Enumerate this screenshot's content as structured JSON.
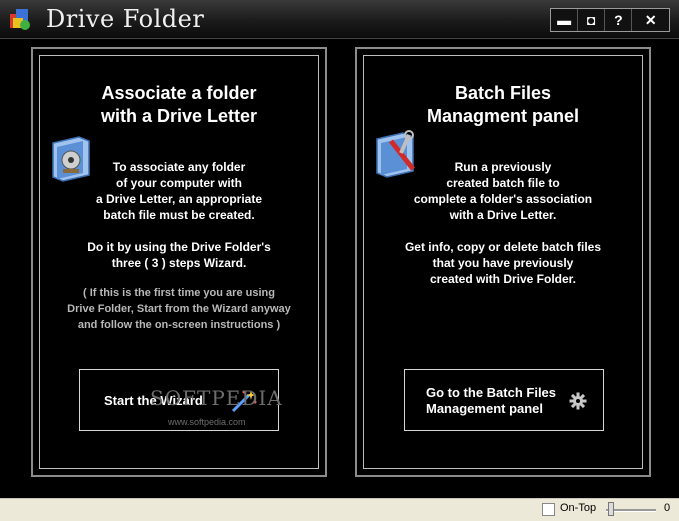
{
  "window": {
    "title": "Drive Folder",
    "controls": [
      "minimize",
      "restore",
      "help",
      "close"
    ],
    "control_labels": [
      "▬",
      "◘",
      "?",
      "✕"
    ]
  },
  "left_panel": {
    "title_line1": "Associate a folder",
    "title_line2": "with a Drive Letter",
    "icon": "folder-disk-icon",
    "para1": [
      "To associate any folder",
      "of your computer with",
      "a Drive Letter, an appropriate",
      "batch file must be created."
    ],
    "para2": [
      "Do it by using the Drive Folder's",
      "three ( 3 ) steps Wizard."
    ],
    "note": [
      "( If this is the first time you are using",
      "Drive Folder, Start from the Wizard anyway",
      "and follow the on-screen instructions )"
    ],
    "button": {
      "label": "Start  the Wizard",
      "icon": "magic-wand-icon"
    }
  },
  "right_panel": {
    "title_line1": "Batch Files",
    "title_line2": "Managment panel",
    "icon": "folder-tools-icon",
    "para1": [
      "Run a previously",
      "created batch file to",
      "complete a folder's association",
      "with a Drive Letter."
    ],
    "para2": [
      "Get info, copy or delete batch files",
      "that you have previously",
      "created with Drive Folder."
    ],
    "button": {
      "label_line1": "Go to the Batch Files",
      "label_line2": "Management panel",
      "icon": "gear-icon"
    }
  },
  "watermark": {
    "text": "SOFTPEDIA",
    "url": "www.softpedia.com"
  },
  "statusbar": {
    "ontop_label": "On-Top",
    "ontop_checked": false,
    "slider_value": "0"
  },
  "colors": {
    "background": "#000000",
    "panel_border": "#8c8c8c",
    "statusbar": "#ece9d8"
  }
}
